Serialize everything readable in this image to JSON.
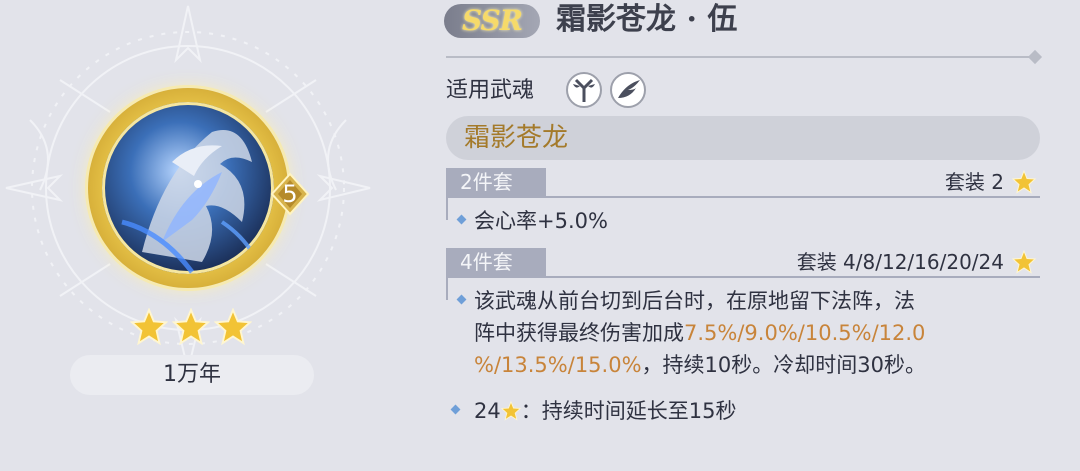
{
  "card": {
    "rarity": "SSR",
    "name": "霜影苍龙 · 伍",
    "level": "5",
    "star_count": 3,
    "age": "1万年"
  },
  "applicable": {
    "label": "适用武魂",
    "icons": [
      "crossed-axe-icon",
      "wing-feather-icon"
    ]
  },
  "set": {
    "name": "霜影苍龙",
    "tiers": [
      {
        "tab": "2件套",
        "requirement": "套装 2",
        "effect": "会心率+5.0%"
      },
      {
        "tab": "4件套",
        "requirement": "套装 4/8/12/16/20/24",
        "effect_line1": "该武魂从前台切到后台时，在原地留下法阵，法",
        "effect_line2_prefix": "阵中获得最终伤害加成",
        "effect_line2_values": "7.5%/9.0%/10.5%/12.0",
        "effect_line3_values": "%/13.5%/15.0%",
        "effect_line3_suffix": "，持续10秒。冷却时间30秒。"
      }
    ],
    "extra": {
      "prefix": "24",
      "text": "：持续时间延长至15秒"
    }
  },
  "colors": {
    "background": "#e2e3ea",
    "gold": "#a47a2a",
    "highlight_orange": "#c8843a",
    "tier_tab": "#a8acbd",
    "star_gold": "#f2c335"
  }
}
